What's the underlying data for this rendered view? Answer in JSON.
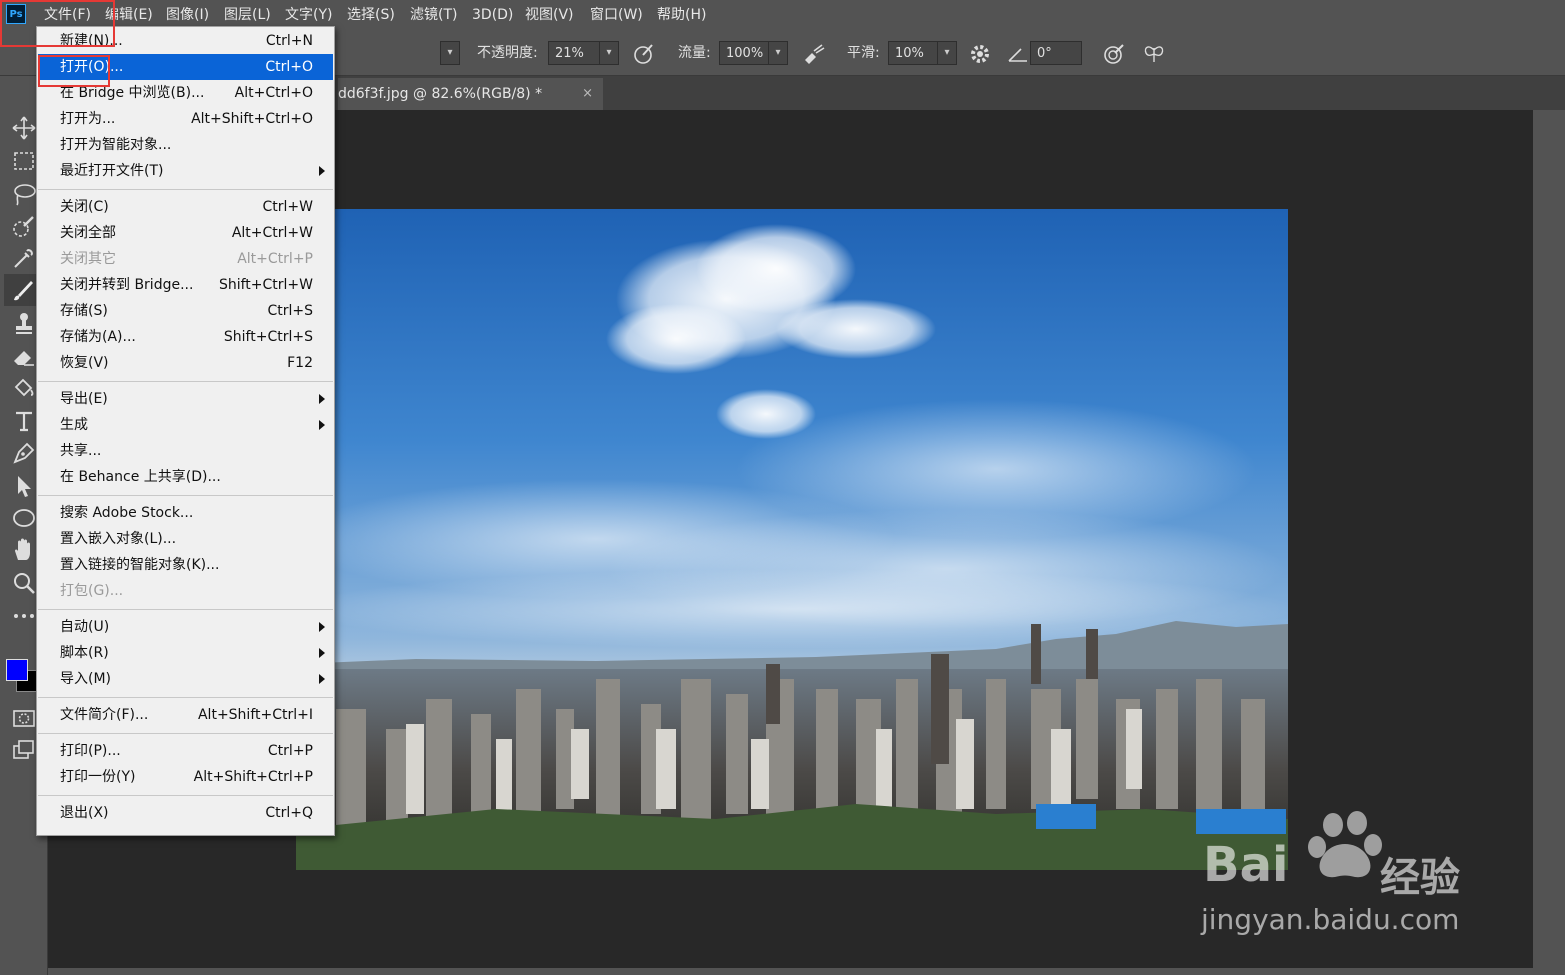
{
  "app": {
    "logo": "Ps"
  },
  "menubar": {
    "items": [
      "文件(F)",
      "编辑(E)",
      "图像(I)",
      "图层(L)",
      "文字(Y)",
      "选择(S)",
      "滤镜(T)",
      "3D(D)",
      "视图(V)",
      "窗口(W)",
      "帮助(H)"
    ]
  },
  "options": {
    "opacity_label": "不透明度:",
    "opacity_value": "21%",
    "flow_label": "流量:",
    "flow_value": "100%",
    "smoothing_label": "平滑:",
    "smoothing_value": "10%",
    "angle_value": "0°"
  },
  "document": {
    "tab_title": "dd6f3f.jpg @ 82.6%(RGB/8) *",
    "close": "×"
  },
  "colors": {
    "foreground": "#0000ff",
    "background": "#000000",
    "highlight": "#0a64d7",
    "annotation": "#e53935"
  },
  "file_menu": {
    "items": [
      {
        "label": "新建(N)...",
        "shortcut": "Ctrl+N"
      },
      {
        "label": "打开(O)...",
        "shortcut": "Ctrl+O",
        "highlighted": true
      },
      {
        "label": "在 Bridge 中浏览(B)...",
        "shortcut": "Alt+Ctrl+O"
      },
      {
        "label": "打开为...",
        "shortcut": "Alt+Shift+Ctrl+O"
      },
      {
        "label": "打开为智能对象...",
        "shortcut": ""
      },
      {
        "label": "最近打开文件(T)",
        "shortcut": "",
        "submenu": true
      },
      {
        "label": "关闭(C)",
        "shortcut": "Ctrl+W"
      },
      {
        "label": "关闭全部",
        "shortcut": "Alt+Ctrl+W"
      },
      {
        "label": "关闭其它",
        "shortcut": "Alt+Ctrl+P",
        "disabled": true
      },
      {
        "label": "关闭并转到 Bridge...",
        "shortcut": "Shift+Ctrl+W"
      },
      {
        "label": "存储(S)",
        "shortcut": "Ctrl+S"
      },
      {
        "label": "存储为(A)...",
        "shortcut": "Shift+Ctrl+S"
      },
      {
        "label": "恢复(V)",
        "shortcut": "F12"
      },
      {
        "label": "导出(E)",
        "shortcut": "",
        "submenu": true
      },
      {
        "label": "生成",
        "shortcut": "",
        "submenu": true
      },
      {
        "label": "共享...",
        "shortcut": ""
      },
      {
        "label": "在 Behance 上共享(D)...",
        "shortcut": ""
      },
      {
        "label": "搜索 Adobe Stock...",
        "shortcut": ""
      },
      {
        "label": "置入嵌入对象(L)...",
        "shortcut": ""
      },
      {
        "label": "置入链接的智能对象(K)...",
        "shortcut": ""
      },
      {
        "label": "打包(G)...",
        "shortcut": "",
        "disabled": true
      },
      {
        "label": "自动(U)",
        "shortcut": "",
        "submenu": true
      },
      {
        "label": "脚本(R)",
        "shortcut": "",
        "submenu": true
      },
      {
        "label": "导入(M)",
        "shortcut": "",
        "submenu": true
      },
      {
        "label": "文件简介(F)...",
        "shortcut": "Alt+Shift+Ctrl+I"
      },
      {
        "label": "打印(P)...",
        "shortcut": "Ctrl+P"
      },
      {
        "label": "打印一份(Y)",
        "shortcut": "Alt+Shift+Ctrl+P"
      },
      {
        "label": "退出(X)",
        "shortcut": "Ctrl+Q"
      }
    ]
  },
  "watermark": {
    "brand": "Bai",
    "brand_cn": "经验",
    "url": "jingyan.baidu.com"
  }
}
